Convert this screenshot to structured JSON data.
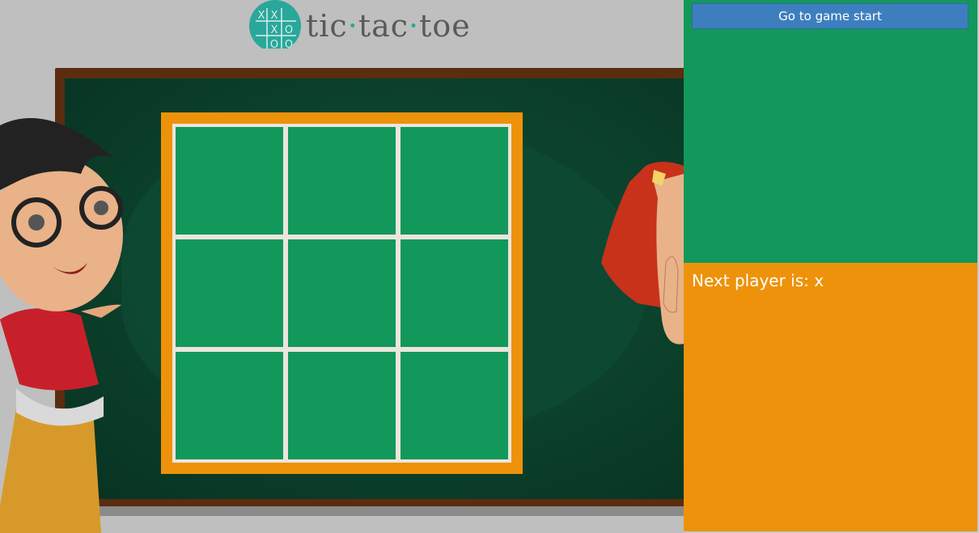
{
  "logo": {
    "text_parts": [
      "tic",
      "tac",
      "toe"
    ],
    "dot": "·",
    "badge_marks": [
      "X",
      "X",
      "X",
      "O",
      "O",
      "O"
    ]
  },
  "board": {
    "cells": [
      "",
      "",
      "",
      "",
      "",
      "",
      "",
      "",
      ""
    ]
  },
  "sidebar": {
    "start_button_label": "Go to game start"
  },
  "status": {
    "text": "Next player is: x"
  },
  "colors": {
    "cell": "#12985a",
    "board_border": "#ee920b",
    "grid_lines": "#ebe6dd",
    "button": "#3d7fbe",
    "chalkboard": "#0b3f2a"
  }
}
